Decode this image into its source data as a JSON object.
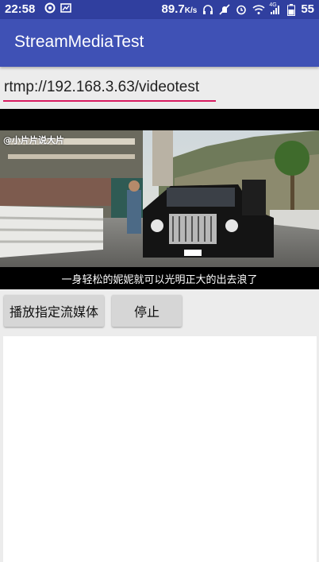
{
  "status_bar": {
    "time": "22:58",
    "speed": "89.7",
    "speed_unit": "K/s",
    "battery": "55",
    "network": "4G",
    "icons": [
      "app-icon",
      "notification-icon",
      "headphones-icon",
      "mute-icon",
      "alarm-icon",
      "wifi-icon",
      "signal-icon",
      "battery-icon"
    ]
  },
  "app_bar": {
    "title": "StreamMediaTest"
  },
  "url_input": {
    "value": "rtmp://192.168.3.63/videotest"
  },
  "video": {
    "watermark": "@小片片说大片",
    "subtitle": "一身轻松的妮妮就可以光明正大的出去浪了"
  },
  "buttons": {
    "play": "播放指定流媒体",
    "stop": "停止"
  },
  "colors": {
    "primary": "#3F51B5",
    "primary_dark": "#303F9F",
    "accent": "#d81b60"
  }
}
